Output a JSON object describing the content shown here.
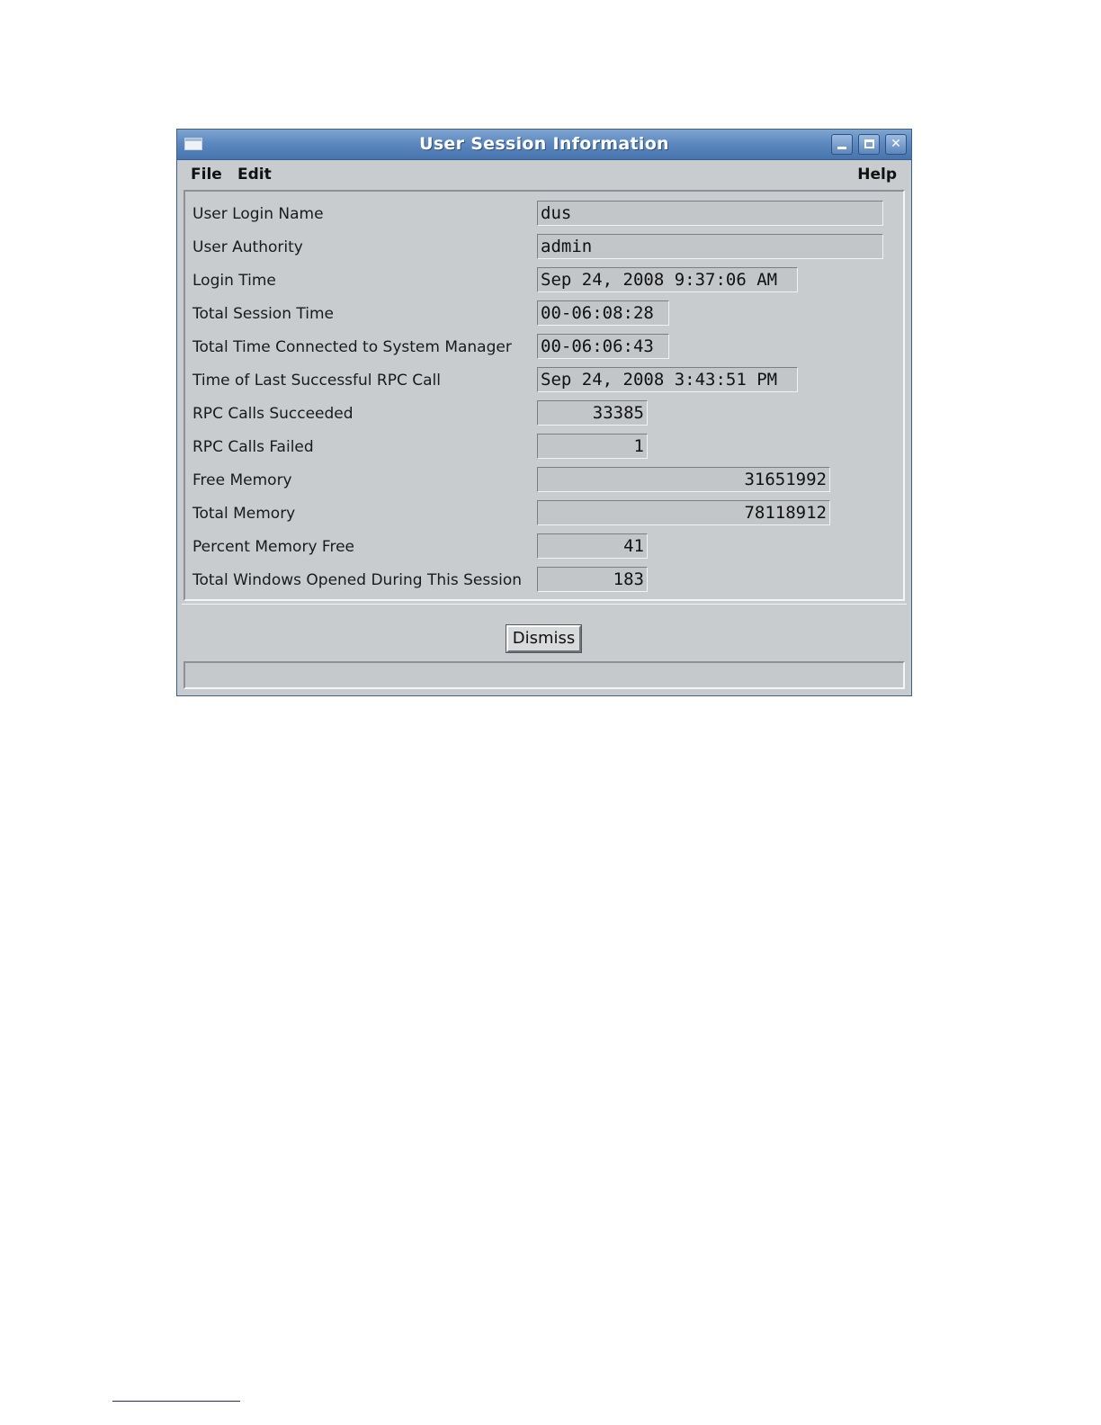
{
  "window": {
    "title": "User Session Information",
    "icons": [
      "window-menu-icon",
      "minimize-icon",
      "maximize-icon",
      "close-icon"
    ]
  },
  "menu": {
    "file": "File",
    "edit": "Edit",
    "help": "Help"
  },
  "fields": [
    {
      "label": "User Login Name",
      "value": "dus"
    },
    {
      "label": "User Authority",
      "value": "admin"
    },
    {
      "label": "Login Time",
      "value": "Sep 24, 2008 9:37:06 AM"
    },
    {
      "label": "Total Session Time",
      "value": "00-06:08:28"
    },
    {
      "label": "Total Time Connected to System Manager",
      "value": "00-06:06:43"
    },
    {
      "label": "Time of Last Successful RPC Call",
      "value": "Sep 24, 2008 3:43:51 PM"
    },
    {
      "label": "RPC Calls Succeeded",
      "value": "33385"
    },
    {
      "label": "RPC Calls Failed",
      "value": "1"
    },
    {
      "label": "Free Memory",
      "value": "31651992"
    },
    {
      "label": "Total Memory",
      "value": "78118912"
    },
    {
      "label": "Percent Memory Free",
      "value": "41"
    },
    {
      "label": "Total Windows Opened During This Session",
      "value": "183"
    }
  ],
  "buttons": {
    "dismiss": "Dismiss"
  },
  "status": {
    "text": ""
  },
  "colors": {
    "titlebar": "#5d89c0",
    "window_bg": "#c9cccf"
  }
}
